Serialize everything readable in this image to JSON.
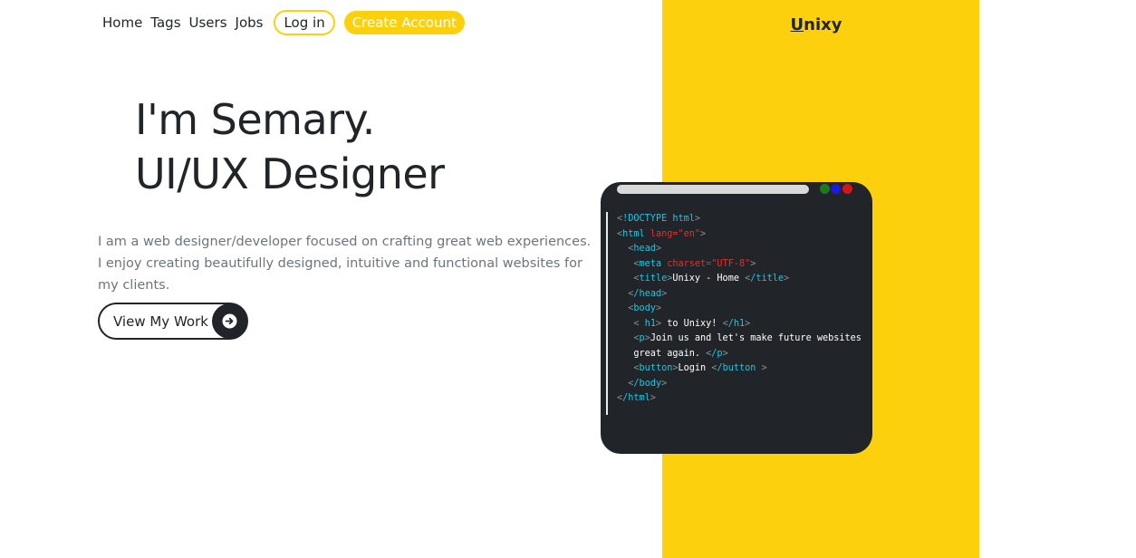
{
  "nav": {
    "home": "Home",
    "tags": "Tags",
    "users": "Users",
    "jobs": "Jobs",
    "login": "Log in",
    "create_account": "Create Account"
  },
  "brand": {
    "first": "U",
    "rest": "nixy"
  },
  "hero": {
    "line1": "I'm Semary.",
    "line2": "UI/UX Designer",
    "bio": "I am a web designer/developer focused on crafting great web experiences. I enjoy creating beautifully designed, intuitive and functional websites for my clients.",
    "cta_label": "View My Work",
    "cta_icon": "arrow-right-circle-icon"
  },
  "code": {
    "doctype": "!DOCTYPE html",
    "html_tag": "html",
    "html_attr": "lang=\"en\"",
    "head": "head",
    "meta": "meta",
    "meta_attr": "charset=\"UTF-8\"",
    "title_tag": "title",
    "title_text": "Unixy - Home ",
    "title_close": "/title",
    "head_close": "/head",
    "body": "body",
    "h1_open": "h1",
    "h1_text": " to Unixy! ",
    "h1_close": "/h1",
    "p_tag": "p",
    "p_text_1": "Join us and let's make future websites",
    "p_text_2": "great again. ",
    "p_close": "/p",
    "button_tag": "button",
    "button_text": "Login ",
    "button_close": "/button",
    "body_close": "/body",
    "html_close": "/html"
  },
  "colors": {
    "accent": "#fcd00d",
    "dark": "#212529",
    "muted": "#6c757d",
    "code_tag": "#22c4e0",
    "code_attr": "#e03030"
  }
}
